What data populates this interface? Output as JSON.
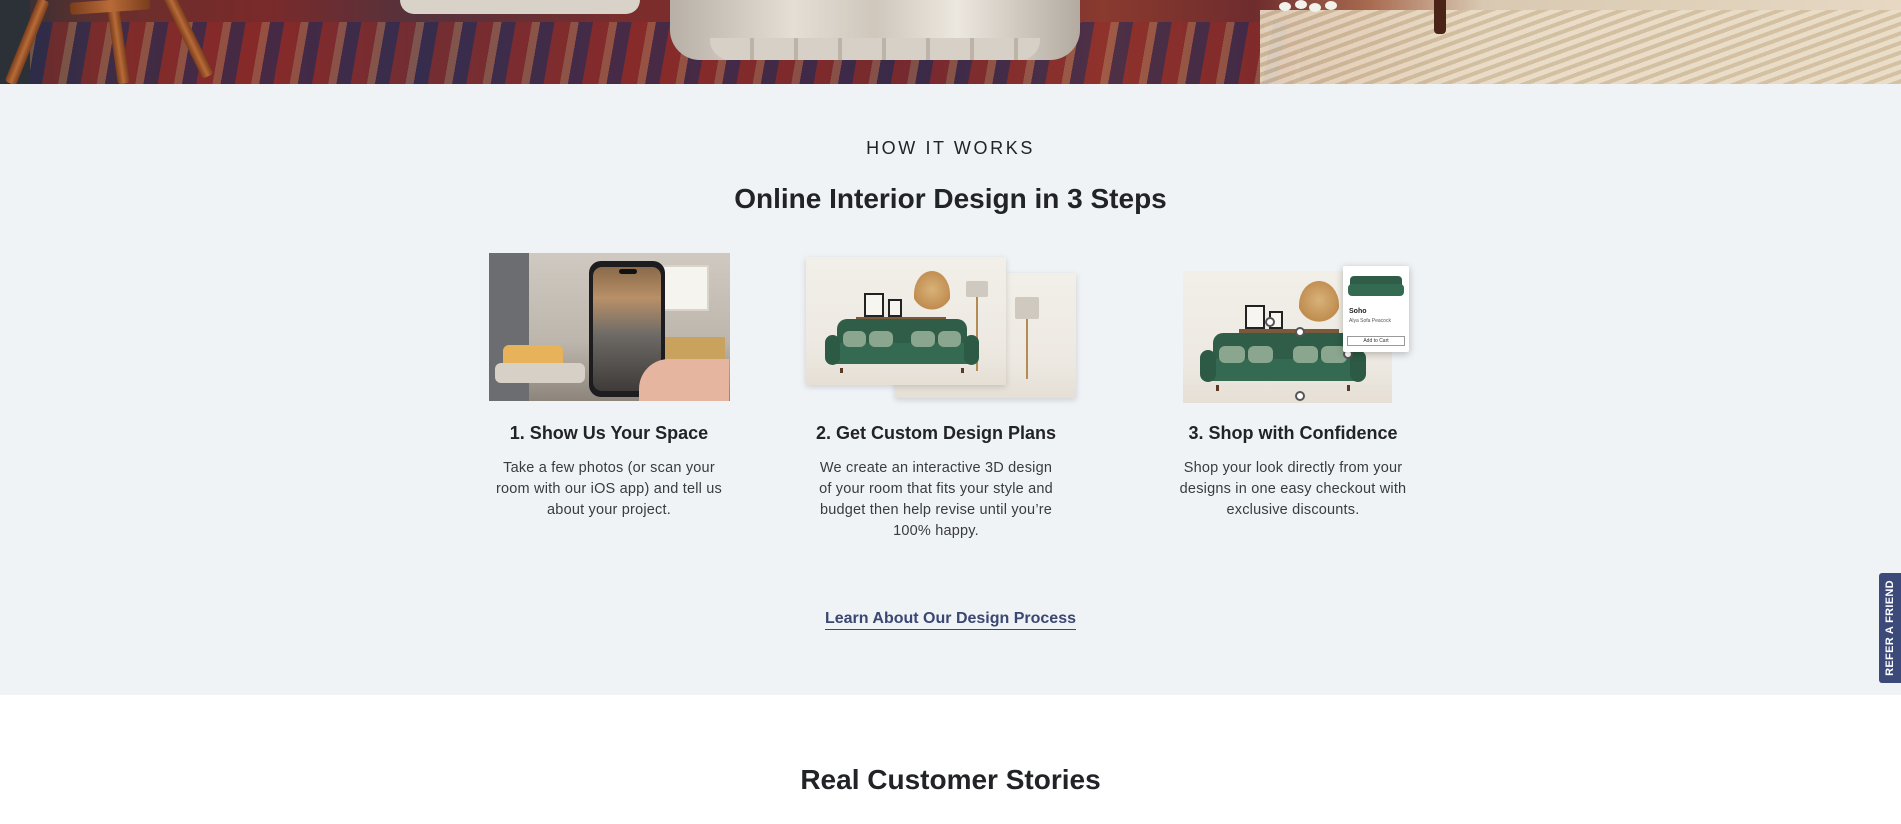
{
  "hero": {
    "alt": "Living room with area rug, wooden chair and stone pedestal table"
  },
  "how_it_works": {
    "eyebrow": "HOW IT WORKS",
    "title": "Online Interior Design in 3 Steps",
    "steps": [
      {
        "title": "1. Show Us Your Space",
        "text": "Take a few photos (or scan your room with our iOS app) and tell us about your project.",
        "image": "phone-scanning-room"
      },
      {
        "title": "2. Get Custom Design Plans",
        "text": "We create an interactive 3D design of your room that fits your style and budget then help revise until you’re 100% happy.",
        "image": "3d-design-renderings"
      },
      {
        "title": "3. Shop with Confidence",
        "text": "Shop your look directly from your designs in one easy checkout with exclusive discounts.",
        "image": "shoppable-design",
        "product_card": {
          "name": "Soho",
          "subtitle": "Alya Sofa Peacock",
          "button": "Add to Cart"
        }
      }
    ],
    "cta": "Learn About Our Design Process"
  },
  "stories": {
    "title": "Real Customer Stories"
  },
  "refer": {
    "label": "REFER A FRIEND"
  },
  "colors": {
    "section_bg": "#f0f3f6",
    "text": "#222326",
    "link": "#3a4771",
    "refer_tab": "#3c4a7a",
    "sofa_green": "#356a52"
  }
}
